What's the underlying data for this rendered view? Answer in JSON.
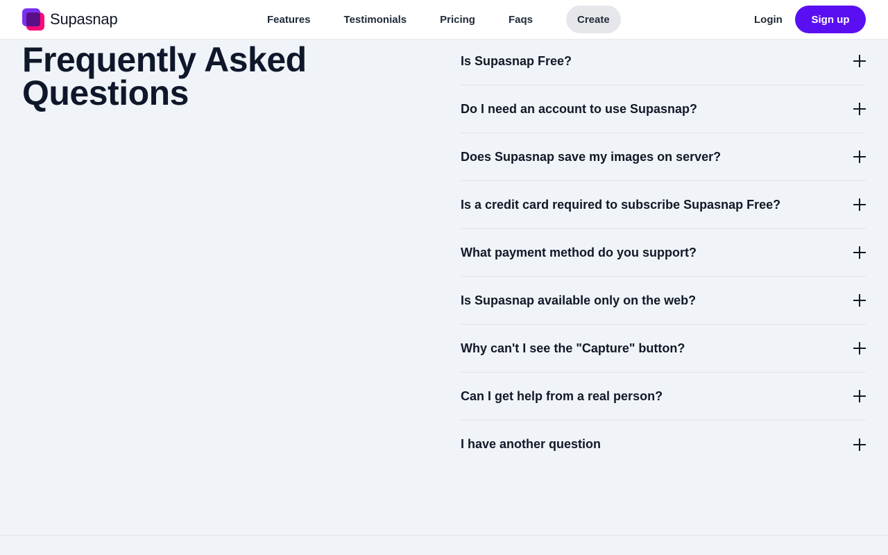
{
  "header": {
    "brand": "Supasnap",
    "nav": [
      "Features",
      "Testimonials",
      "Pricing",
      "Faqs",
      "Create"
    ],
    "active_nav": "Create",
    "login": "Login",
    "signup": "Sign up"
  },
  "colors": {
    "accent": "#5a0ff2",
    "logo_pink": "#ff0a7a",
    "logo_purple": "#6d1ff0",
    "background": "#f0f4f8"
  },
  "faq": {
    "title": "Frequently Asked Questions",
    "items": [
      "Is Supasnap Free?",
      "Do I need an account to use Supasnap?",
      "Does Supasnap save my images on server?",
      "Is a credit card required to subscribe Supasnap Free?",
      "What payment method do you support?",
      "Is Supasnap available only on the web?",
      "Why can't I see the \"Capture\" button?",
      "Can I get help from a real person?",
      "I have another question"
    ],
    "expand_icon": "plus-icon"
  }
}
